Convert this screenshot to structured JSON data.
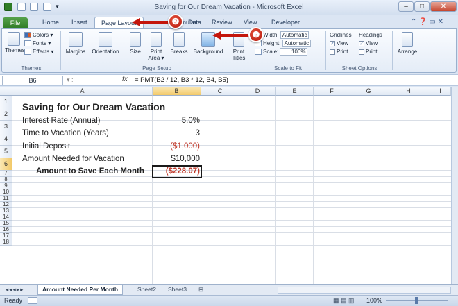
{
  "window": {
    "title": "Saving for Our Dream Vacation - Microsoft Excel",
    "controls": {
      "minimize": "–",
      "maximize": "□",
      "close": "✕"
    }
  },
  "qat": {
    "icons": [
      "excel-app-icon",
      "save-icon",
      "undo-icon",
      "redo-icon",
      "customize-qat-icon"
    ]
  },
  "tabs": [
    {
      "label": "File"
    },
    {
      "label": "Home"
    },
    {
      "label": "Insert"
    },
    {
      "label": "Page Layout"
    },
    {
      "label": "Formulas"
    },
    {
      "label": "Data"
    },
    {
      "label": "Review"
    },
    {
      "label": "View"
    },
    {
      "label": "Developer"
    }
  ],
  "ribbon": {
    "themes": {
      "big": "Themes",
      "colors": "Colors ▾",
      "fonts": "Fonts ▾",
      "effects": "Effects ▾",
      "group": "Themes"
    },
    "page_setup": {
      "margins": "Margins",
      "orientation": "Orientation",
      "size": "Size",
      "print_area": "Print Area ▾",
      "breaks": "Breaks",
      "background": "Background",
      "print_titles": "Print Titles",
      "group": "Page Setup"
    },
    "scale": {
      "width_label": "Width:",
      "width_value": "Automatic",
      "height_label": "Height:",
      "height_value": "Automatic",
      "scale_label": "Scale:",
      "scale_value": "100%",
      "group": "Scale to Fit"
    },
    "sheet_options": {
      "gridlines": "Gridlines",
      "headings": "Headings",
      "view": "View",
      "print": "Print",
      "gridlines_view": true,
      "headings_view": true,
      "group": "Sheet Options"
    },
    "arrange": {
      "label": "Arrange"
    }
  },
  "callouts": {
    "step2": "❷",
    "step3": "❸"
  },
  "formula_bar": {
    "name_box": "B6",
    "fx": "fx",
    "formula": "= PMT(B2 / 12, B3 * 12, B4, B5)"
  },
  "columns": [
    "A",
    "B",
    "C",
    "D",
    "E",
    "F",
    "G",
    "H",
    "I"
  ],
  "rows": [
    "1",
    "2",
    "3",
    "4",
    "5",
    "6",
    "7",
    "8",
    "9",
    "10",
    "11",
    "12",
    "13",
    "14",
    "15",
    "16",
    "17",
    "18"
  ],
  "cells": {
    "a1": "Saving for Our Dream Vacation",
    "a2": "Interest Rate (Annual)",
    "b2": "5.0%",
    "a3": "Time to Vacation (Years)",
    "b3": "3",
    "a4": "Initial Deposit",
    "b4": "($1,000)",
    "a5": "Amount Needed for Vacation",
    "b5": "$10,000",
    "a6": "Amount to Save Each Month",
    "b6": "($228.07)"
  },
  "sheet_tabs": [
    "Amount Needed Per Month",
    "Sheet2",
    "Sheet3"
  ],
  "status": {
    "ready": "Ready",
    "zoom": "100%"
  },
  "colors": {
    "accent": "#c4160c",
    "file_tab": "#2f7c26",
    "negative": "#c0392b"
  }
}
